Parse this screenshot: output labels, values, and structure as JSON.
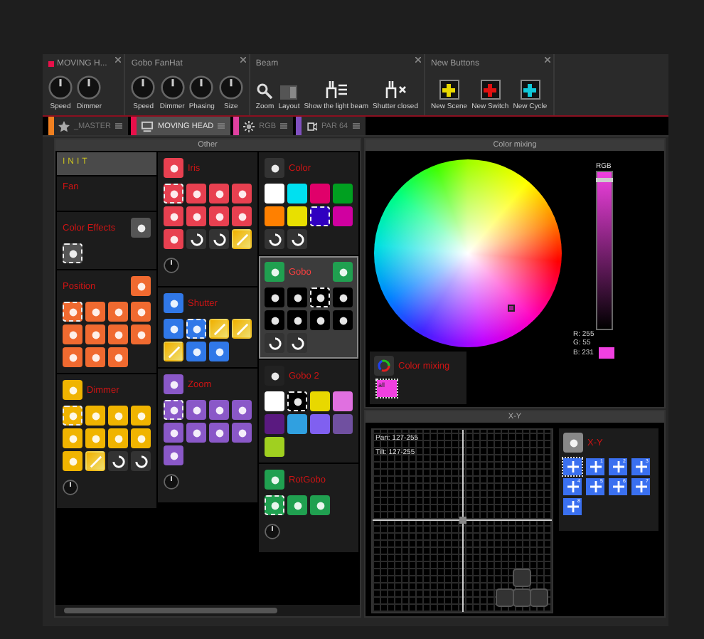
{
  "toolbar": {
    "groups": [
      {
        "title": "MOVING H...",
        "marker": true,
        "controls": [
          {
            "kind": "knob",
            "label": "Speed"
          },
          {
            "kind": "knob",
            "label": "Dimmer"
          }
        ]
      },
      {
        "title": "Gobo FanHat",
        "marker": false,
        "controls": [
          {
            "kind": "knob",
            "label": "Speed"
          },
          {
            "kind": "knob",
            "label": "Dimmer"
          },
          {
            "kind": "knob",
            "label": "Phasing"
          },
          {
            "kind": "knob",
            "label": "Size"
          }
        ]
      },
      {
        "title": "Beam",
        "marker": false,
        "controls": [
          {
            "kind": "zoom",
            "label": "Zoom"
          },
          {
            "kind": "layout",
            "label": "Layout"
          },
          {
            "kind": "beam",
            "label": "Show the light beam"
          },
          {
            "kind": "shutter",
            "label": "Shutter closed"
          }
        ]
      },
      {
        "title": "New Buttons",
        "marker": false,
        "controls": [
          {
            "kind": "plus",
            "label": "New Scene",
            "color": "#e8d800"
          },
          {
            "kind": "plus",
            "label": "New Switch",
            "color": "#e01010"
          },
          {
            "kind": "plus",
            "label": "New Cycle",
            "color": "#10c8d8"
          }
        ]
      }
    ]
  },
  "tabs": [
    {
      "label": "_MASTER",
      "kind": "star",
      "color": "#f08020",
      "selected": false
    },
    {
      "label": "MOVING HEAD",
      "kind": "head",
      "color": "#e8104a",
      "selected": true
    },
    {
      "label": "RGB",
      "kind": "sun",
      "color": "#e040a0",
      "selected": false
    },
    {
      "label": "PAR 64",
      "kind": "lamp",
      "color": "#8050c0",
      "selected": false
    }
  ],
  "other": {
    "title": "Other",
    "columns": [
      [
        {
          "kind": "init",
          "title": "INIT",
          "selected": true
        },
        {
          "kind": "plain",
          "title": "Fan",
          "selected": false
        },
        {
          "kind": "effects",
          "title": "Color Effects",
          "icon_before": false,
          "icon_after": true,
          "selected": false,
          "knob": false,
          "buttons": [
            {
              "kind": "tile",
              "selected": true
            }
          ]
        },
        {
          "kind": "position",
          "title": "Position",
          "icon_before": false,
          "icon_after": true,
          "selected": false,
          "knob": false,
          "buttons": [
            {
              "kind": "tile",
              "selected": true
            },
            {
              "kind": "tile",
              "selected": false
            },
            {
              "kind": "tile",
              "selected": false
            },
            {
              "kind": "tile",
              "selected": false
            },
            {
              "kind": "tile",
              "selected": false
            },
            {
              "kind": "tile",
              "selected": false
            },
            {
              "kind": "tile",
              "selected": false
            },
            {
              "kind": "tile",
              "selected": false
            },
            {
              "kind": "tile",
              "selected": false
            },
            {
              "kind": "tile",
              "selected": false
            },
            {
              "kind": "tile",
              "selected": false
            }
          ]
        },
        {
          "kind": "dimmer",
          "title": "Dimmer",
          "icon_before": true,
          "icon_after": false,
          "selected": false,
          "knob": true,
          "buttons": [
            {
              "kind": "tile",
              "selected": true
            },
            {
              "kind": "tile",
              "selected": false
            },
            {
              "kind": "tile",
              "selected": false
            },
            {
              "kind": "tile",
              "selected": false
            },
            {
              "kind": "tile",
              "selected": false
            },
            {
              "kind": "tile",
              "selected": false
            },
            {
              "kind": "tile",
              "selected": false
            },
            {
              "kind": "tile",
              "selected": false
            },
            {
              "kind": "tile",
              "selected": false
            },
            {
              "kind": "fade",
              "selected": false
            },
            {
              "kind": "cycle",
              "selected": false
            },
            {
              "kind": "cycle",
              "selected": false
            }
          ]
        }
      ],
      [
        {
          "kind": "iris",
          "title": "Iris",
          "icon_before": true,
          "icon_after": false,
          "selected": false,
          "knob": true,
          "buttons": [
            {
              "kind": "tile",
              "selected": true
            },
            {
              "kind": "tile",
              "selected": false
            },
            {
              "kind": "tile",
              "selected": false
            },
            {
              "kind": "tile",
              "selected": false
            },
            {
              "kind": "tile",
              "selected": false
            },
            {
              "kind": "tile",
              "selected": false
            },
            {
              "kind": "tile",
              "selected": false
            },
            {
              "kind": "tile",
              "selected": false
            },
            {
              "kind": "tile",
              "selected": false
            },
            {
              "kind": "cycle",
              "selected": false
            },
            {
              "kind": "cycle",
              "selected": false
            },
            {
              "kind": "fade",
              "selected": false
            }
          ]
        },
        {
          "kind": "shutter",
          "title": "Shutter",
          "icon_before": true,
          "icon_after": false,
          "selected": false,
          "knob": false,
          "buttons": [
            {
              "kind": "tile",
              "selected": false
            },
            {
              "kind": "tile",
              "selected": true
            },
            {
              "kind": "fade",
              "selected": false
            },
            {
              "kind": "fade",
              "selected": false
            },
            {
              "kind": "fade",
              "selected": false
            },
            {
              "kind": "tile",
              "selected": false
            },
            {
              "kind": "tile",
              "selected": false
            }
          ]
        },
        {
          "kind": "zoom",
          "title": "Zoom",
          "icon_before": true,
          "icon_after": false,
          "selected": false,
          "knob": true,
          "buttons": [
            {
              "kind": "tile",
              "selected": true
            },
            {
              "kind": "tile",
              "selected": false
            },
            {
              "kind": "tile",
              "selected": false
            },
            {
              "kind": "tile",
              "selected": false
            },
            {
              "kind": "tile",
              "selected": false
            },
            {
              "kind": "tile",
              "selected": false
            },
            {
              "kind": "tile",
              "selected": false
            },
            {
              "kind": "tile",
              "selected": false
            },
            {
              "kind": "tile",
              "selected": false
            }
          ]
        }
      ],
      [
        {
          "kind": "color",
          "title": "Color",
          "icon_before": true,
          "icon_after": false,
          "selected": false,
          "knob": false,
          "buttons": [
            {
              "kind": "swatch",
              "color": "#ffffff",
              "selected": false
            },
            {
              "kind": "swatch",
              "color": "#00e0f0",
              "selected": false
            },
            {
              "kind": "swatch",
              "color": "#e0006a",
              "selected": false
            },
            {
              "kind": "swatch",
              "color": "#00a020",
              "selected": false
            },
            {
              "kind": "swatch",
              "color": "#ff8000",
              "selected": false
            },
            {
              "kind": "swatch",
              "color": "#e8e000",
              "selected": false
            },
            {
              "kind": "swatch",
              "color": "#3000c0",
              "selected": true
            },
            {
              "kind": "swatch",
              "color": "#d000a0",
              "selected": false
            },
            {
              "kind": "cycle",
              "selected": false
            },
            {
              "kind": "cycle",
              "selected": false
            }
          ]
        },
        {
          "kind": "gobo",
          "title": "Gobo",
          "icon_before": true,
          "icon_after": true,
          "selected": true,
          "knob": false,
          "buttons": [
            {
              "kind": "gobo",
              "selected": false
            },
            {
              "kind": "gobo",
              "selected": false
            },
            {
              "kind": "gobo",
              "selected": true
            },
            {
              "kind": "gobo",
              "selected": false
            },
            {
              "kind": "gobo",
              "selected": false
            },
            {
              "kind": "gobo",
              "selected": false
            },
            {
              "kind": "gobo",
              "selected": false
            },
            {
              "kind": "gobo",
              "selected": false
            },
            {
              "kind": "cycle",
              "selected": false
            },
            {
              "kind": "cycle",
              "selected": false
            }
          ]
        },
        {
          "kind": "gobo2",
          "title": "Gobo 2",
          "icon_before": true,
          "icon_after": false,
          "selected": false,
          "knob": false,
          "buttons": [
            {
              "kind": "swatch",
              "color": "#ffffff",
              "selected": false
            },
            {
              "kind": "gobo",
              "selected": true
            },
            {
              "kind": "swatch",
              "color": "#e8d800",
              "selected": false
            },
            {
              "kind": "swatch",
              "color": "#e070e0",
              "selected": false
            },
            {
              "kind": "swatch",
              "color": "#5a1a80",
              "selected": false
            },
            {
              "kind": "swatch",
              "color": "#30a0e0",
              "selected": false
            },
            {
              "kind": "swatch",
              "color": "#8060f0",
              "selected": false
            },
            {
              "kind": "swatch",
              "color": "#7050a0",
              "selected": false
            },
            {
              "kind": "swatch",
              "color": "#a0d020",
              "selected": false
            }
          ]
        },
        {
          "kind": "rotgobo",
          "title": "RotGobo",
          "icon_before": true,
          "icon_after": false,
          "selected": false,
          "knob": true,
          "buttons": [
            {
              "kind": "tile",
              "selected": true
            },
            {
              "kind": "tile",
              "selected": false
            },
            {
              "kind": "tile",
              "selected": false
            }
          ]
        }
      ]
    ]
  },
  "color_mixing": {
    "title": "Color mixing",
    "slider": {
      "label": "RGB",
      "level": 0.96
    },
    "readouts": [
      "R: 255",
      "G:  55",
      "B: 231"
    ],
    "section": {
      "title": "Color mixing",
      "buttons": [
        {
          "label": "all",
          "selected": true
        }
      ]
    }
  },
  "xy": {
    "title": "X-Y",
    "readouts": [
      "Pan: 127-255",
      "Tilt: 127-255"
    ],
    "section": {
      "title": "X-Y",
      "buttons": [
        {
          "selected": true
        },
        {
          "label": "1",
          "selected": false
        },
        {
          "label": "2",
          "selected": false
        },
        {
          "label": "3",
          "selected": false
        },
        {
          "label": "4",
          "selected": false
        },
        {
          "label": "5",
          "selected": false
        },
        {
          "label": "6",
          "selected": false
        },
        {
          "label": "7",
          "selected": false
        },
        {
          "label": "8",
          "selected": false
        }
      ]
    }
  }
}
